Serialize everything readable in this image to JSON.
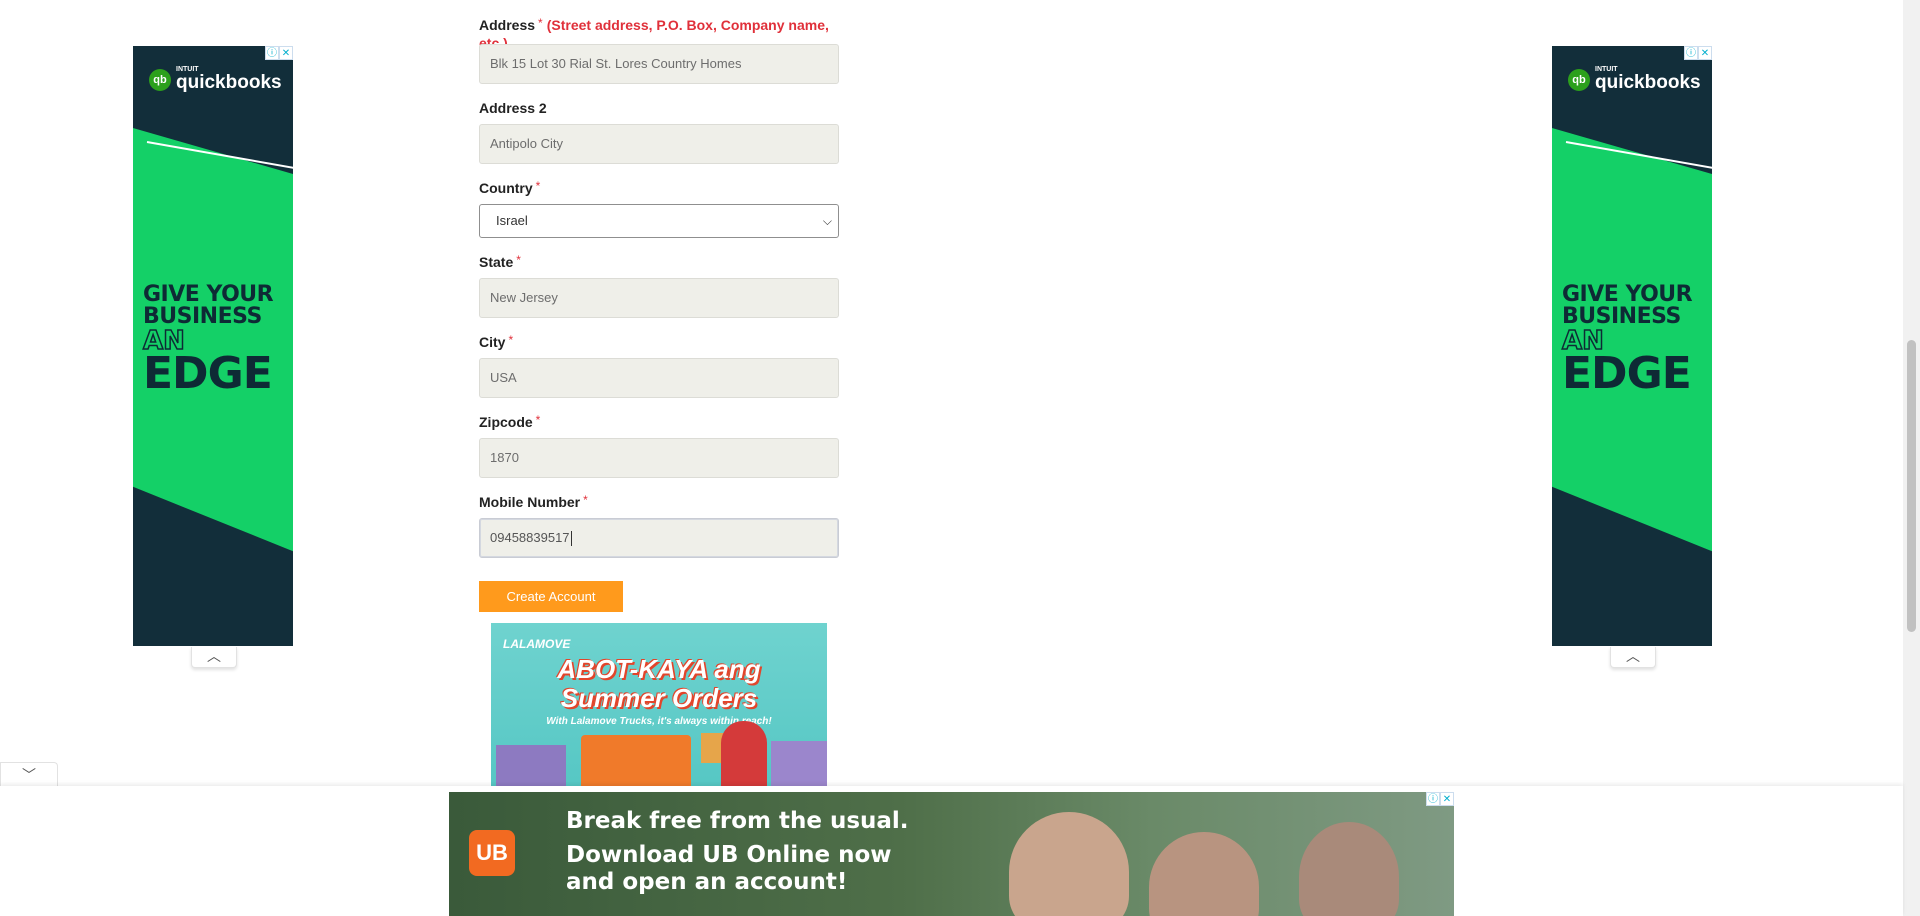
{
  "form": {
    "address": {
      "label": "Address",
      "required_mark": "*",
      "hint": "(Street address, P.O. Box, Company name, etc.)",
      "value": "Blk 15 Lot 30 Rial St. Lores Country Homes"
    },
    "address2": {
      "label": "Address 2",
      "value": "Antipolo City"
    },
    "country": {
      "label": "Country",
      "required_mark": "*",
      "selected": "Israel"
    },
    "state": {
      "label": "State",
      "required_mark": "*",
      "value": "New Jersey"
    },
    "city": {
      "label": "City",
      "required_mark": "*",
      "value": "USA"
    },
    "zipcode": {
      "label": "Zipcode",
      "required_mark": "*",
      "value": "1870"
    },
    "mobile": {
      "label": "Mobile Number",
      "required_mark": "*",
      "value": "09458839517"
    },
    "submit_label": "Create Account"
  },
  "ads": {
    "side_left": {
      "intuit": "INTUIT",
      "brand": "quickbooks",
      "logo_glyph": "qb",
      "copy_line1": "GIVE YOUR",
      "copy_line2": "BUSINESS",
      "copy_line3": "AN",
      "copy_line4": "EDGE",
      "info_icon": "ⓘ",
      "close_icon": "✕",
      "collapse_icon": "︿"
    },
    "side_right": {
      "intuit": "INTUIT",
      "brand": "quickbooks",
      "logo_glyph": "qb",
      "copy_line1": "GIVE YOUR",
      "copy_line2": "BUSINESS",
      "copy_line3": "AN",
      "copy_line4": "EDGE",
      "info_icon": "ⓘ",
      "close_icon": "✕",
      "collapse_icon": "︿"
    },
    "lalamove": {
      "logo": "LALAMOVE",
      "headline1": "ABOT-KAYA ang",
      "headline2": "Summer Orders",
      "tagline": "With Lalamove Trucks, it's always within reach!"
    },
    "bottom": {
      "logo_glyph": "UB",
      "line1": "Break free from the usual.",
      "line2": "Download UB Online now",
      "line3": "and open an account!",
      "info_icon": "ⓘ",
      "close_icon": "✕"
    },
    "anchor_toggle_icon": "﹀"
  },
  "colors": {
    "accent_orange": "#ff9a1c",
    "required_red": "#e0303a",
    "quickbooks_green": "#14d067",
    "quickbooks_dark": "#122e3a"
  }
}
